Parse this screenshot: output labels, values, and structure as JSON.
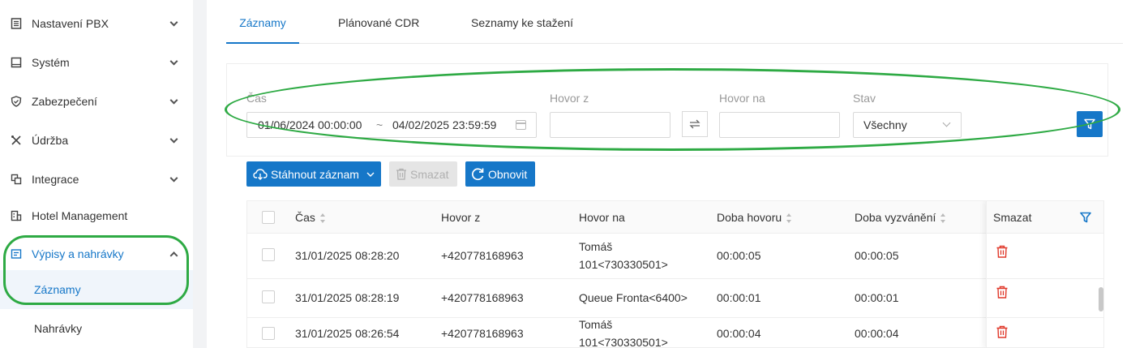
{
  "sidebar": {
    "items": [
      {
        "label": "Nastavení PBX",
        "icon": "list-icon"
      },
      {
        "label": "Systém",
        "icon": "monitor-icon"
      },
      {
        "label": "Zabezpečení",
        "icon": "shield-icon"
      },
      {
        "label": "Údržba",
        "icon": "tools-icon"
      },
      {
        "label": "Integrace",
        "icon": "integration-icon"
      },
      {
        "label": "Hotel Management",
        "icon": "hotel-icon"
      },
      {
        "label": "Výpisy a nahrávky",
        "icon": "report-icon"
      }
    ],
    "subitems": [
      {
        "label": "Záznamy"
      },
      {
        "label": "Nahrávky"
      }
    ],
    "accent": "#1677c8"
  },
  "tabs": [
    {
      "label": "Záznamy"
    },
    {
      "label": "Plánované CDR"
    },
    {
      "label": "Seznamy ke stažení"
    }
  ],
  "filters": {
    "time_label": "Čas",
    "time_from": "01/06/2024 00:00:00",
    "time_sep": "~",
    "time_to": "04/02/2025 23:59:59",
    "from_label": "Hovor z",
    "from_value": "",
    "to_label": "Hovor na",
    "to_value": "",
    "status_label": "Stav",
    "status_value": "Všechny"
  },
  "toolbar": {
    "download_label": "Stáhnout záznam",
    "delete_label": "Smazat",
    "refresh_label": "Obnovit"
  },
  "table": {
    "headers": {
      "time": "Čas",
      "from": "Hovor z",
      "to": "Hovor na",
      "duration": "Doba hovoru",
      "ring": "Doba vyzvánění",
      "delete": "Smazat"
    },
    "rows": [
      {
        "time": "31/01/2025 08:28:20",
        "from": "+420778168963",
        "to_line1": "Tomáš",
        "to_line2": "101<730330501>",
        "duration": "00:00:05",
        "ring": "00:00:05"
      },
      {
        "time": "31/01/2025 08:28:19",
        "from": "+420778168963",
        "to_line1": "Queue Fronta<6400>",
        "to_line2": "",
        "duration": "00:00:01",
        "ring": "00:00:01"
      },
      {
        "time": "31/01/2025 08:26:54",
        "from": "+420778168963",
        "to_line1": "Tomáš",
        "to_line2": "101<730330501>",
        "duration": "00:00:04",
        "ring": "00:00:04"
      }
    ]
  },
  "colors": {
    "primary": "#1677c8",
    "delete": "#e0392b",
    "highlight": "#2eaa44"
  }
}
